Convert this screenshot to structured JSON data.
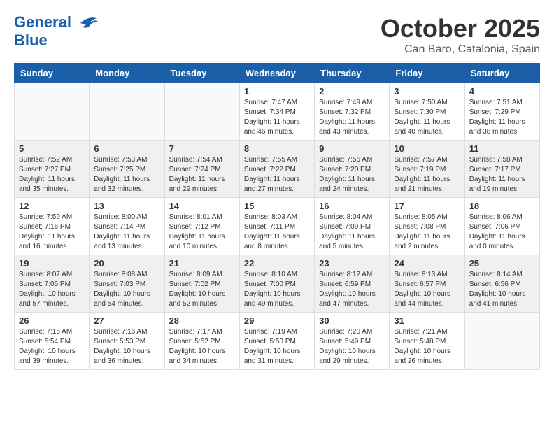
{
  "header": {
    "logo_line1": "General",
    "logo_line2": "Blue",
    "month": "October 2025",
    "location": "Can Baro, Catalonia, Spain"
  },
  "weekdays": [
    "Sunday",
    "Monday",
    "Tuesday",
    "Wednesday",
    "Thursday",
    "Friday",
    "Saturday"
  ],
  "weeks": [
    [
      {
        "day": "",
        "info": ""
      },
      {
        "day": "",
        "info": ""
      },
      {
        "day": "",
        "info": ""
      },
      {
        "day": "1",
        "info": "Sunrise: 7:47 AM\nSunset: 7:34 PM\nDaylight: 11 hours\nand 46 minutes."
      },
      {
        "day": "2",
        "info": "Sunrise: 7:49 AM\nSunset: 7:32 PM\nDaylight: 11 hours\nand 43 minutes."
      },
      {
        "day": "3",
        "info": "Sunrise: 7:50 AM\nSunset: 7:30 PM\nDaylight: 11 hours\nand 40 minutes."
      },
      {
        "day": "4",
        "info": "Sunrise: 7:51 AM\nSunset: 7:29 PM\nDaylight: 11 hours\nand 38 minutes."
      }
    ],
    [
      {
        "day": "5",
        "info": "Sunrise: 7:52 AM\nSunset: 7:27 PM\nDaylight: 11 hours\nand 35 minutes."
      },
      {
        "day": "6",
        "info": "Sunrise: 7:53 AM\nSunset: 7:25 PM\nDaylight: 11 hours\nand 32 minutes."
      },
      {
        "day": "7",
        "info": "Sunrise: 7:54 AM\nSunset: 7:24 PM\nDaylight: 11 hours\nand 29 minutes."
      },
      {
        "day": "8",
        "info": "Sunrise: 7:55 AM\nSunset: 7:22 PM\nDaylight: 11 hours\nand 27 minutes."
      },
      {
        "day": "9",
        "info": "Sunrise: 7:56 AM\nSunset: 7:20 PM\nDaylight: 11 hours\nand 24 minutes."
      },
      {
        "day": "10",
        "info": "Sunrise: 7:57 AM\nSunset: 7:19 PM\nDaylight: 11 hours\nand 21 minutes."
      },
      {
        "day": "11",
        "info": "Sunrise: 7:58 AM\nSunset: 7:17 PM\nDaylight: 11 hours\nand 19 minutes."
      }
    ],
    [
      {
        "day": "12",
        "info": "Sunrise: 7:59 AM\nSunset: 7:16 PM\nDaylight: 11 hours\nand 16 minutes."
      },
      {
        "day": "13",
        "info": "Sunrise: 8:00 AM\nSunset: 7:14 PM\nDaylight: 11 hours\nand 13 minutes."
      },
      {
        "day": "14",
        "info": "Sunrise: 8:01 AM\nSunset: 7:12 PM\nDaylight: 11 hours\nand 10 minutes."
      },
      {
        "day": "15",
        "info": "Sunrise: 8:03 AM\nSunset: 7:11 PM\nDaylight: 11 hours\nand 8 minutes."
      },
      {
        "day": "16",
        "info": "Sunrise: 8:04 AM\nSunset: 7:09 PM\nDaylight: 11 hours\nand 5 minutes."
      },
      {
        "day": "17",
        "info": "Sunrise: 8:05 AM\nSunset: 7:08 PM\nDaylight: 11 hours\nand 2 minutes."
      },
      {
        "day": "18",
        "info": "Sunrise: 8:06 AM\nSunset: 7:06 PM\nDaylight: 11 hours\nand 0 minutes."
      }
    ],
    [
      {
        "day": "19",
        "info": "Sunrise: 8:07 AM\nSunset: 7:05 PM\nDaylight: 10 hours\nand 57 minutes."
      },
      {
        "day": "20",
        "info": "Sunrise: 8:08 AM\nSunset: 7:03 PM\nDaylight: 10 hours\nand 54 minutes."
      },
      {
        "day": "21",
        "info": "Sunrise: 8:09 AM\nSunset: 7:02 PM\nDaylight: 10 hours\nand 52 minutes."
      },
      {
        "day": "22",
        "info": "Sunrise: 8:10 AM\nSunset: 7:00 PM\nDaylight: 10 hours\nand 49 minutes."
      },
      {
        "day": "23",
        "info": "Sunrise: 8:12 AM\nSunset: 6:59 PM\nDaylight: 10 hours\nand 47 minutes."
      },
      {
        "day": "24",
        "info": "Sunrise: 8:13 AM\nSunset: 6:57 PM\nDaylight: 10 hours\nand 44 minutes."
      },
      {
        "day": "25",
        "info": "Sunrise: 8:14 AM\nSunset: 6:56 PM\nDaylight: 10 hours\nand 41 minutes."
      }
    ],
    [
      {
        "day": "26",
        "info": "Sunrise: 7:15 AM\nSunset: 5:54 PM\nDaylight: 10 hours\nand 39 minutes."
      },
      {
        "day": "27",
        "info": "Sunrise: 7:16 AM\nSunset: 5:53 PM\nDaylight: 10 hours\nand 36 minutes."
      },
      {
        "day": "28",
        "info": "Sunrise: 7:17 AM\nSunset: 5:52 PM\nDaylight: 10 hours\nand 34 minutes."
      },
      {
        "day": "29",
        "info": "Sunrise: 7:19 AM\nSunset: 5:50 PM\nDaylight: 10 hours\nand 31 minutes."
      },
      {
        "day": "30",
        "info": "Sunrise: 7:20 AM\nSunset: 5:49 PM\nDaylight: 10 hours\nand 29 minutes."
      },
      {
        "day": "31",
        "info": "Sunrise: 7:21 AM\nSunset: 5:48 PM\nDaylight: 10 hours\nand 26 minutes."
      },
      {
        "day": "",
        "info": ""
      }
    ]
  ]
}
